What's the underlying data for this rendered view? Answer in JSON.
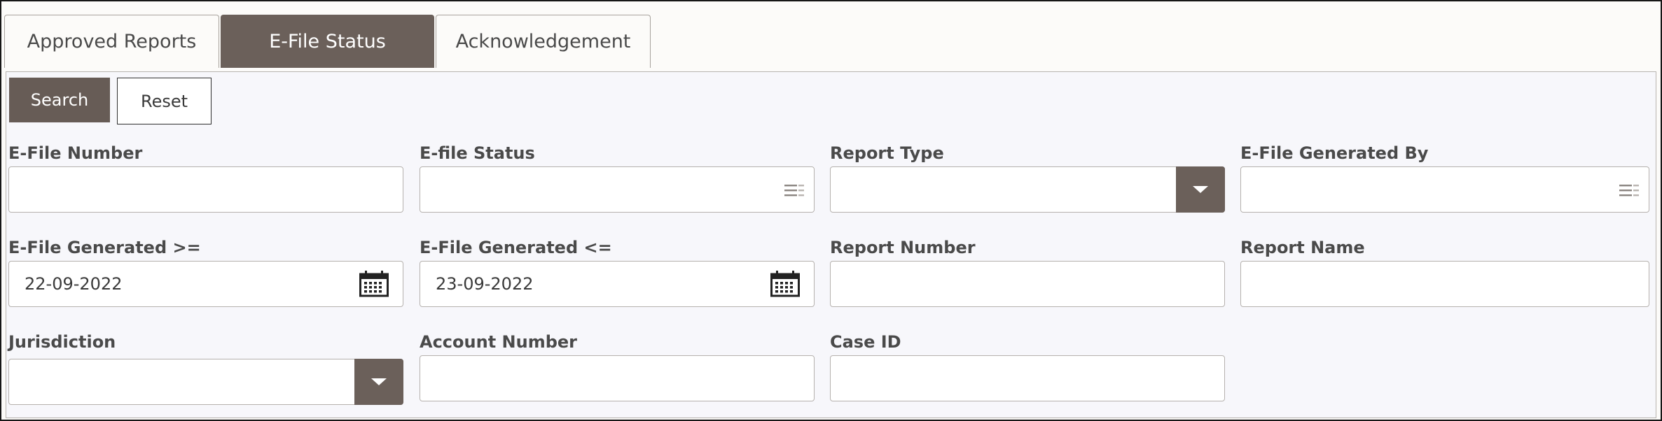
{
  "tabs": [
    {
      "label": "Approved Reports"
    },
    {
      "label": "E-File Status"
    },
    {
      "label": "Acknowledgement"
    }
  ],
  "toolbar": {
    "search_label": "Search",
    "reset_label": "Reset"
  },
  "fields": {
    "efile_number": {
      "label": "E-File Number",
      "value": ""
    },
    "efile_status": {
      "label": "E-file Status",
      "value": ""
    },
    "report_type": {
      "label": "Report Type",
      "value": ""
    },
    "efile_generated_by": {
      "label": "E-File Generated By",
      "value": ""
    },
    "efile_generated_from": {
      "label": "E-File Generated >=",
      "value": "22-09-2022"
    },
    "efile_generated_to": {
      "label": "E-File Generated <=",
      "value": "23-09-2022"
    },
    "report_number": {
      "label": "Report Number",
      "value": ""
    },
    "report_name": {
      "label": "Report Name",
      "value": ""
    },
    "jurisdiction": {
      "label": "Jurisdiction",
      "value": ""
    },
    "account_number": {
      "label": "Account Number",
      "value": ""
    },
    "case_id": {
      "label": "Case ID",
      "value": ""
    }
  },
  "colors": {
    "accent": "#6b605a",
    "page_bg": "#fcfbf9",
    "panel_bg": "#f7f7fb"
  },
  "icons": {
    "lov": "list-icon",
    "date": "calendar-icon",
    "dropdown": "chevron-down-icon"
  }
}
